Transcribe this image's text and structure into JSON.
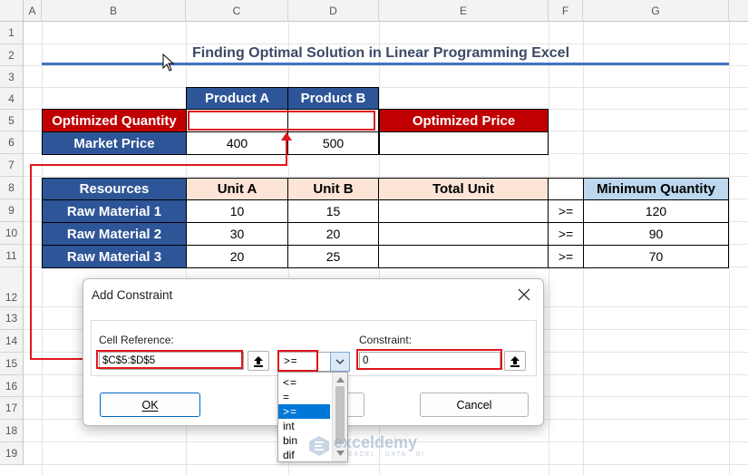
{
  "sheet": {
    "columns": [
      "A",
      "B",
      "C",
      "D",
      "E",
      "F",
      "G"
    ],
    "rows": [
      "1",
      "2",
      "3",
      "4",
      "5",
      "6",
      "7",
      "8",
      "9",
      "10",
      "11",
      "12",
      "13",
      "14",
      "15",
      "16",
      "17",
      "18",
      "19"
    ],
    "title": "Finding Optimal Solution in Linear Programming Excel",
    "product_table": {
      "headers": [
        "Product A",
        "Product B"
      ],
      "optimized_quantity_label": "Optimized Quantity",
      "market_price_label": "Market Price",
      "market_prices": [
        "400",
        "500"
      ],
      "optimized_price_label": "Optimized Price"
    },
    "resource_table": {
      "headers": [
        "Resources",
        "Unit A",
        "Unit B",
        "Total Unit",
        "",
        "Minimum Quantity"
      ],
      "rows": [
        {
          "name": "Raw Material 1",
          "unit_a": "10",
          "unit_b": "15",
          "op": ">=",
          "min": "120"
        },
        {
          "name": "Raw Material 2",
          "unit_a": "30",
          "unit_b": "20",
          "op": ">=",
          "min": "90"
        },
        {
          "name": "Raw Material 3",
          "unit_a": "20",
          "unit_b": "25",
          "op": ">=",
          "min": "70"
        }
      ]
    }
  },
  "dialog": {
    "title": "Add Constraint",
    "cell_reference_label": "Cell Reference:",
    "cell_reference_value": "$C$5:$D$5",
    "constraint_label": "Constraint:",
    "constraint_value": "0",
    "operator_selected": ">=",
    "operator_options": [
      "<=",
      "=",
      ">=",
      "int",
      "bin",
      "dif"
    ],
    "ok_label": "OK",
    "cancel_label": "Cancel"
  },
  "watermark": {
    "brand": "exceldemy",
    "tagline": "EXCEL · DATA · BI"
  },
  "colors": {
    "header_blue": "#2e5597",
    "header_red": "#c00000",
    "header_peach": "#fce4d6",
    "header_lightblue": "#bdd7ee",
    "annotation_red": "#e0161e"
  }
}
